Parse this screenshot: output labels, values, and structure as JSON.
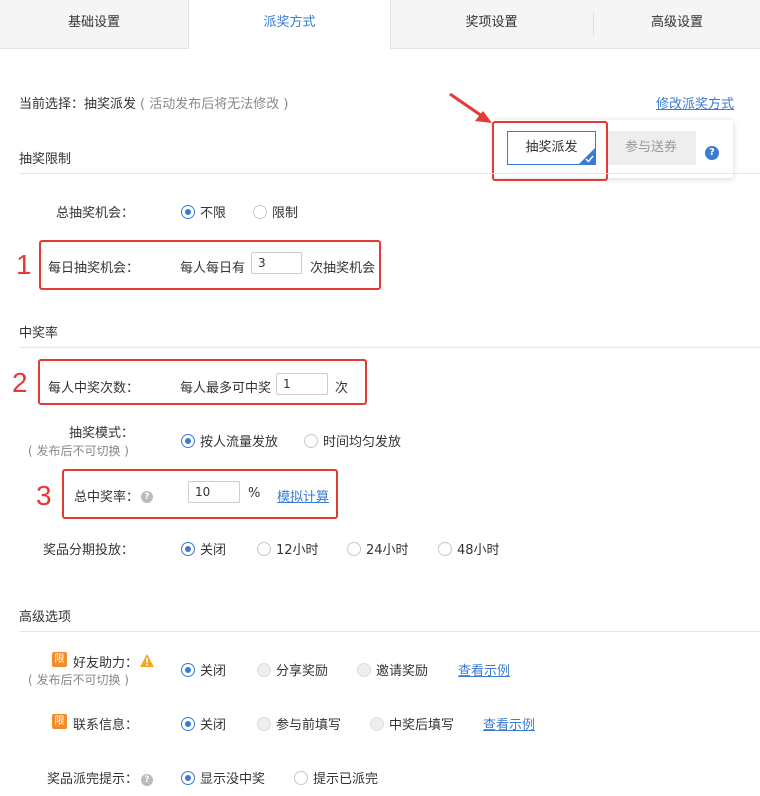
{
  "tabs": [
    "基础设置",
    "派奖方式",
    "奖项设置",
    "高级设置"
  ],
  "current": {
    "label": "当前选择：",
    "value": "抽奖派发",
    "note": "( 活动发布后将无法修改 )",
    "modify_link": "修改派奖方式"
  },
  "popup": {
    "option1": "抽奖派发",
    "option2": "参与送券",
    "help": "?"
  },
  "sections": {
    "limit": "抽奖限制",
    "rate": "中奖率",
    "advanced": "高级选项"
  },
  "total_chance": {
    "label": "总抽奖机会：",
    "options": [
      "不限",
      "限制"
    ]
  },
  "daily_chance": {
    "label": "每日抽奖机会：",
    "prefix": "每人每日有",
    "value": "3",
    "suffix": "次抽奖机会"
  },
  "win_times": {
    "label": "每人中奖次数：",
    "prefix": "每人最多可中奖",
    "value": "1",
    "suffix": "次"
  },
  "mode": {
    "label": "抽奖模式：",
    "sub": "( 发布后不可切换 )",
    "options": [
      "按人流量发放",
      "时间均匀发放"
    ]
  },
  "total_rate": {
    "label": "总中奖率：",
    "value": "10",
    "unit": "%",
    "link": "模拟计算"
  },
  "staged": {
    "label": "奖品分期投放：",
    "options": [
      "关闭",
      "12小时",
      "24小时",
      "48小时"
    ]
  },
  "friend_help": {
    "badge": "限",
    "label": "好友助力：",
    "sub": "( 发布后不可切换 )",
    "options": [
      "关闭",
      "分享奖励",
      "邀请奖励"
    ],
    "link": "查看示例"
  },
  "contact": {
    "badge": "限",
    "label": "联系信息：",
    "options": [
      "关闭",
      "参与前填写",
      "中奖后填写"
    ],
    "link": "查看示例"
  },
  "depleted": {
    "label": "奖品派完提示：",
    "options": [
      "显示没中奖",
      "提示已派完"
    ]
  },
  "annotations": [
    "1",
    "2",
    "3"
  ],
  "colors": {
    "accent": "#3a7bd5",
    "annotation": "#e53935",
    "badge": "#f28c28"
  }
}
